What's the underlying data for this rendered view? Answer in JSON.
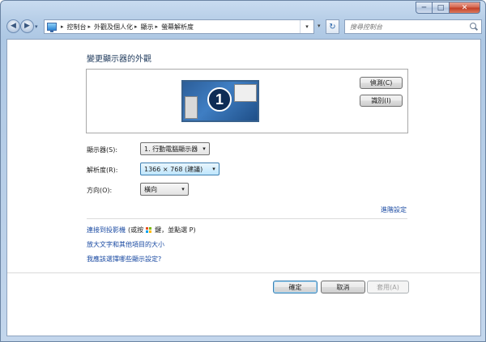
{
  "window": {
    "minimize_glyph": "─",
    "maximize_glyph": "□",
    "close_glyph": "✕"
  },
  "nav": {
    "back_glyph": "◀",
    "forward_glyph": "▶",
    "history_glyph": "▾",
    "breadcrumbs": [
      "控制台",
      "外觀及個人化",
      "顯示",
      "螢幕解析度"
    ],
    "breadcrumb_separator": "▸",
    "address_dropdown_glyph": "▾",
    "refresh_glyph": "↻",
    "search_placeholder": "搜尋控制台"
  },
  "page": {
    "title": "變更顯示器的外觀",
    "monitor_number": "1",
    "detect_button": "偵測(C)",
    "identify_button": "識別(I)"
  },
  "settings": {
    "display_label": "顯示器(S):",
    "display_value": "1. 行動電腦顯示器",
    "resolution_label": "解析度(R):",
    "resolution_value": "1366 × 768 (建議)",
    "orientation_label": "方向(O):",
    "orientation_value": "橫向",
    "dropdown_glyph": "▾"
  },
  "links": {
    "advanced_settings": "進階設定",
    "projector_link": "連接到投影機",
    "projector_hint_prefix": "(或按",
    "projector_hint_suffix": "鍵，並點選 P)",
    "text_size_link": "放大文字和其他項目的大小",
    "which_settings_link": "我應該選擇哪些顯示設定?"
  },
  "footer": {
    "ok_button": "確定",
    "cancel_button": "取消",
    "apply_button": "套用(A)"
  }
}
